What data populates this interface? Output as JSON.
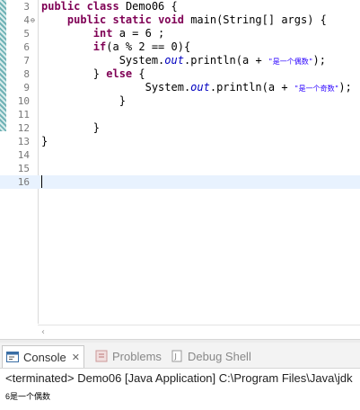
{
  "editor": {
    "lines": [
      {
        "n": "3",
        "fold": "",
        "tokens": [
          [
            "kw",
            "public "
          ],
          [
            "kw",
            "class "
          ],
          [
            "",
            "Demo06 {"
          ]
        ]
      },
      {
        "n": "4",
        "fold": "⊖",
        "tokens": [
          [
            "",
            "    "
          ],
          [
            "kw",
            "public "
          ],
          [
            "kw",
            "static "
          ],
          [
            "kw",
            "void "
          ],
          [
            "",
            "main(String[] args) {"
          ]
        ]
      },
      {
        "n": "5",
        "fold": "",
        "tokens": [
          [
            "",
            "        "
          ],
          [
            "kw",
            "int "
          ],
          [
            "",
            "a = 6 ;"
          ]
        ]
      },
      {
        "n": "6",
        "fold": "",
        "tokens": [
          [
            "",
            "        "
          ],
          [
            "kw",
            "if"
          ],
          [
            "",
            "(a % 2 == 0){"
          ]
        ]
      },
      {
        "n": "7",
        "fold": "",
        "tokens": [
          [
            "",
            "            System."
          ],
          [
            "fld",
            "out"
          ],
          [
            "",
            ".println(a + "
          ],
          [
            "str",
            "\"是一个偶数\""
          ],
          [
            "",
            ");"
          ]
        ]
      },
      {
        "n": "8",
        "fold": "",
        "tokens": [
          [
            "",
            "        } "
          ],
          [
            "kw",
            "else "
          ],
          [
            "",
            "{"
          ]
        ]
      },
      {
        "n": "9",
        "fold": "",
        "tokens": [
          [
            "",
            "                System."
          ],
          [
            "fld",
            "out"
          ],
          [
            "",
            ".println(a + "
          ],
          [
            "str",
            "\"是一个奇数\""
          ],
          [
            "",
            ");"
          ]
        ]
      },
      {
        "n": "10",
        "fold": "",
        "tokens": [
          [
            "",
            "            }"
          ]
        ]
      },
      {
        "n": "11",
        "fold": "",
        "tokens": []
      },
      {
        "n": "12",
        "fold": "",
        "tokens": [
          [
            "",
            "        }"
          ]
        ]
      },
      {
        "n": "13",
        "fold": "",
        "tokens": [
          [
            "",
            "}"
          ]
        ]
      },
      {
        "n": "14",
        "fold": "",
        "tokens": []
      },
      {
        "n": "15",
        "fold": "",
        "tokens": []
      },
      {
        "n": "16",
        "fold": "",
        "tokens": [],
        "current": true
      }
    ]
  },
  "tabs": {
    "console": "Console",
    "console_close": "✕",
    "problems": "Problems",
    "debug_shell": "Debug Shell"
  },
  "console": {
    "terminated": "<terminated> Demo06 [Java Application] C:\\Program Files\\Java\\jdk",
    "output": "6是一个偶数"
  },
  "icons": {
    "console": "console-icon",
    "problems": "problems-icon",
    "debug_shell": "debug-shell-icon",
    "scroll_left": "scroll-left-arrow"
  },
  "colors": {
    "keyword": "#7f0055",
    "field": "#0000c0",
    "string": "#2a00ff",
    "current_line": "#e8f2fe"
  }
}
